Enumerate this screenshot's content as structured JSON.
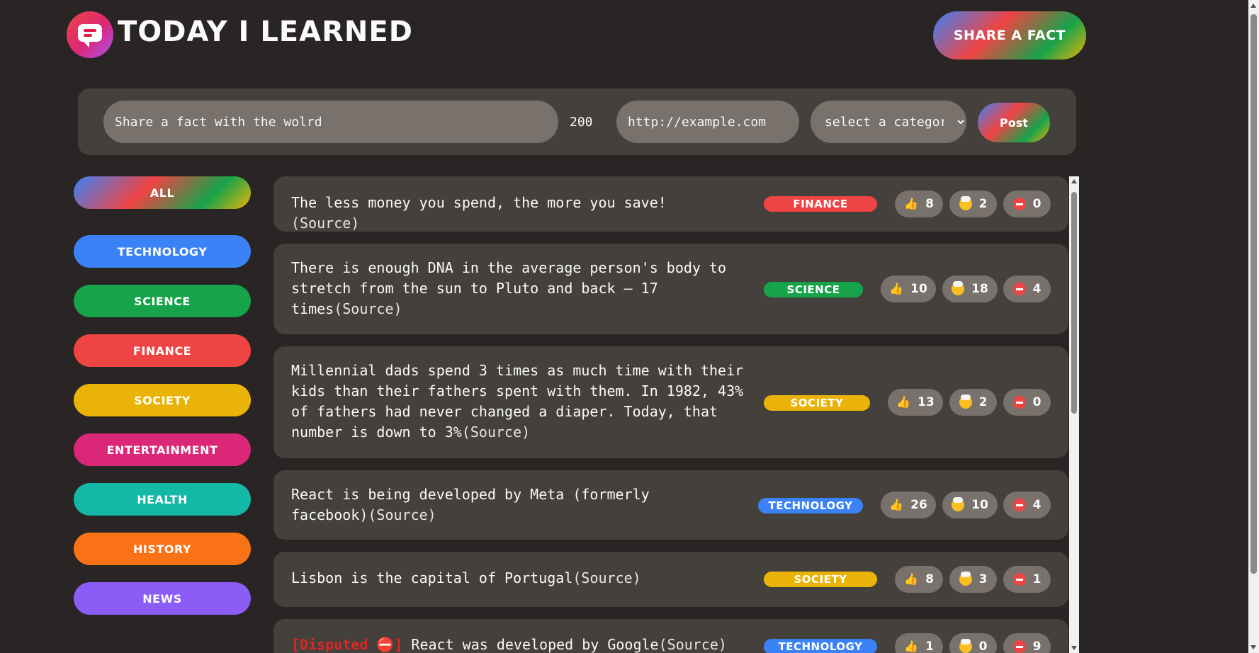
{
  "app": {
    "title": "TODAY I LEARNED"
  },
  "header": {
    "share_label": "SHARE A FACT"
  },
  "form": {
    "fact_placeholder": "Share a fact with the wolrd",
    "char_count": "200",
    "url_placeholder": "http://example.com",
    "category_selected": "select a category:",
    "post_label": "Post"
  },
  "sidebar": {
    "items": [
      {
        "label": "ALL",
        "color": "gradient"
      },
      {
        "label": "TECHNOLOGY",
        "color": "#3b82f6"
      },
      {
        "label": "SCIENCE",
        "color": "#16a34a"
      },
      {
        "label": "FINANCE",
        "color": "#ef4444"
      },
      {
        "label": "SOCIETY",
        "color": "#eab308"
      },
      {
        "label": "ENTERTAINMENT",
        "color": "#db2777"
      },
      {
        "label": "HEALTH",
        "color": "#14b8a6"
      },
      {
        "label": "HISTORY",
        "color": "#f97316"
      },
      {
        "label": "NEWS",
        "color": "#8b5cf6"
      }
    ]
  },
  "facts": [
    {
      "text": "The less money you spend, the more you save!",
      "source": "(Source)",
      "category": "FINANCE",
      "category_color": "#ef4444",
      "likes": "8",
      "mindblowing": "2",
      "false": "0",
      "disputed": ""
    },
    {
      "text": "There is enough DNA in the average person's body to stretch from the sun to Pluto and back — 17 times",
      "source": "(Source)",
      "category": "SCIENCE",
      "category_color": "#16a34a",
      "likes": "10",
      "mindblowing": "18",
      "false": "4",
      "disputed": ""
    },
    {
      "text": "Millennial dads spend 3 times as much time with their kids than their fathers spent with them. In 1982, 43% of fathers had never changed a diaper. Today, that number is down to 3%",
      "source": "(Source)",
      "category": "SOCIETY",
      "category_color": "#eab308",
      "likes": "13",
      "mindblowing": "2",
      "false": "0",
      "disputed": ""
    },
    {
      "text": "React is being developed by Meta (formerly facebook)",
      "source": "(Source)",
      "category": "TECHNOLOGY",
      "category_color": "#3b82f6",
      "likes": "26",
      "mindblowing": "10",
      "false": "4",
      "disputed": ""
    },
    {
      "text": "Lisbon is the capital of Portugal",
      "source": "(Source)",
      "category": "SOCIETY",
      "category_color": "#eab308",
      "likes": "8",
      "mindblowing": "3",
      "false": "1",
      "disputed": ""
    },
    {
      "text": "React was developed by Google",
      "source": "(Source)",
      "category": "TECHNOLOGY",
      "category_color": "#3b82f6",
      "likes": "1",
      "mindblowing": "0",
      "false": "9",
      "disputed": "[Disputed ⛔]"
    }
  ],
  "icons": {
    "like": "thumbs-up-icon",
    "mindblowing": "mind-blown-icon",
    "false": "no-entry-icon"
  }
}
